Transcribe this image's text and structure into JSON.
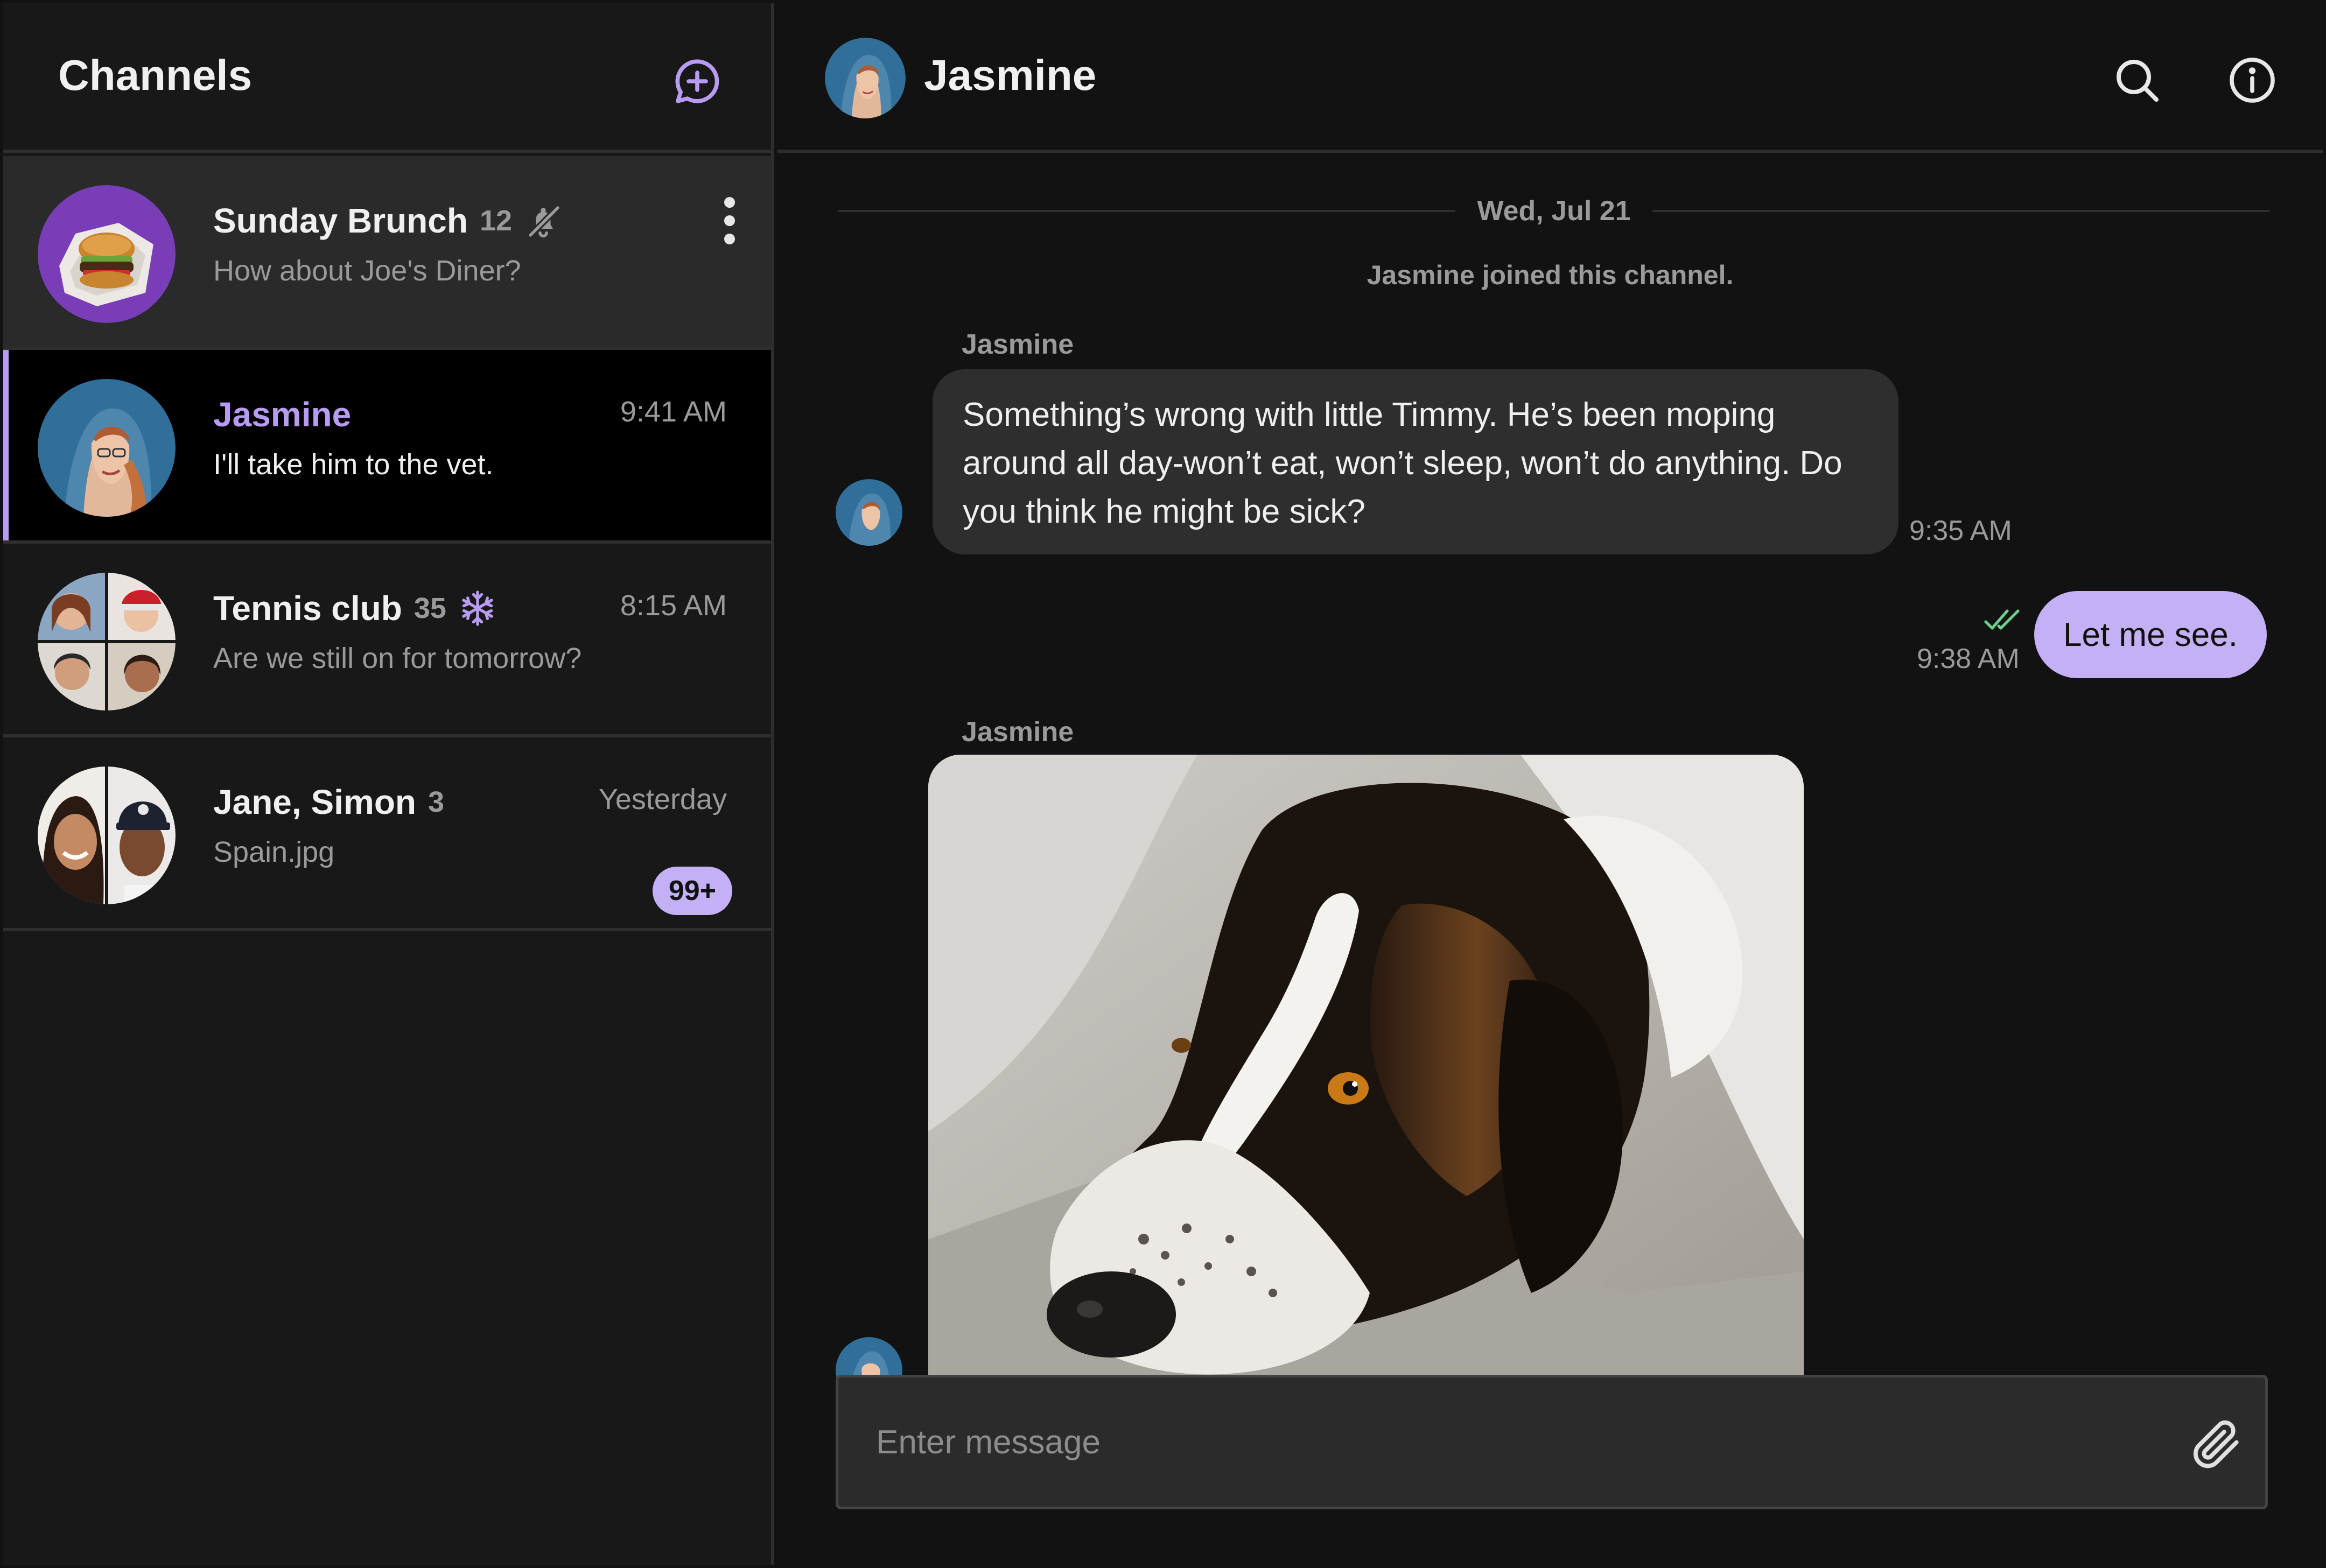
{
  "sidebar": {
    "title": "Channels",
    "channels": [
      {
        "name": "Sunday Brunch",
        "count": "12",
        "preview": "How about Joe's Diner?",
        "time": "",
        "muted": true
      },
      {
        "name": "Jasmine",
        "count": "",
        "preview": "I'll take him to the vet.",
        "time": "9:41 AM"
      },
      {
        "name": "Tennis club",
        "count": "35",
        "preview": "Are we still on for tomorrow?",
        "time": "8:15 AM",
        "frozen": true
      },
      {
        "name": "Jane, Simon",
        "count": "3",
        "preview": "Spain.jpg",
        "time": "Yesterday",
        "unread_badge": "99+"
      }
    ]
  },
  "conversation": {
    "title": "Jasmine",
    "date_separator": "Wed, Jul 21",
    "system_message": "Jasmine joined this channel.",
    "messages": [
      {
        "sender": "Jasmine",
        "text": "Something’s wrong with little Timmy. He’s been moping around all day-won’t eat, won’t sleep, won’t do anything. Do you think he might be sick?",
        "time": "9:35 AM"
      },
      {
        "sender": "",
        "text": "Let me see.",
        "time": "9:38 AM",
        "status": "read"
      },
      {
        "sender": "Jasmine",
        "attachment": "dog-photo"
      }
    ],
    "composer": {
      "placeholder": "Enter message"
    }
  },
  "colors": {
    "accent": "#b89cf4",
    "accent_light": "#c4b0f5",
    "read_check": "#6fcf8c",
    "background": "#121212",
    "sidebar_background": "#181818"
  },
  "icons": {
    "new_channel": "chat-plus-icon",
    "search": "search-icon",
    "info": "info-icon",
    "attach": "paperclip-icon",
    "muted": "bell-off-icon",
    "frozen": "snowflake-icon",
    "more": "more-vertical-icon",
    "read": "double-check-icon"
  }
}
